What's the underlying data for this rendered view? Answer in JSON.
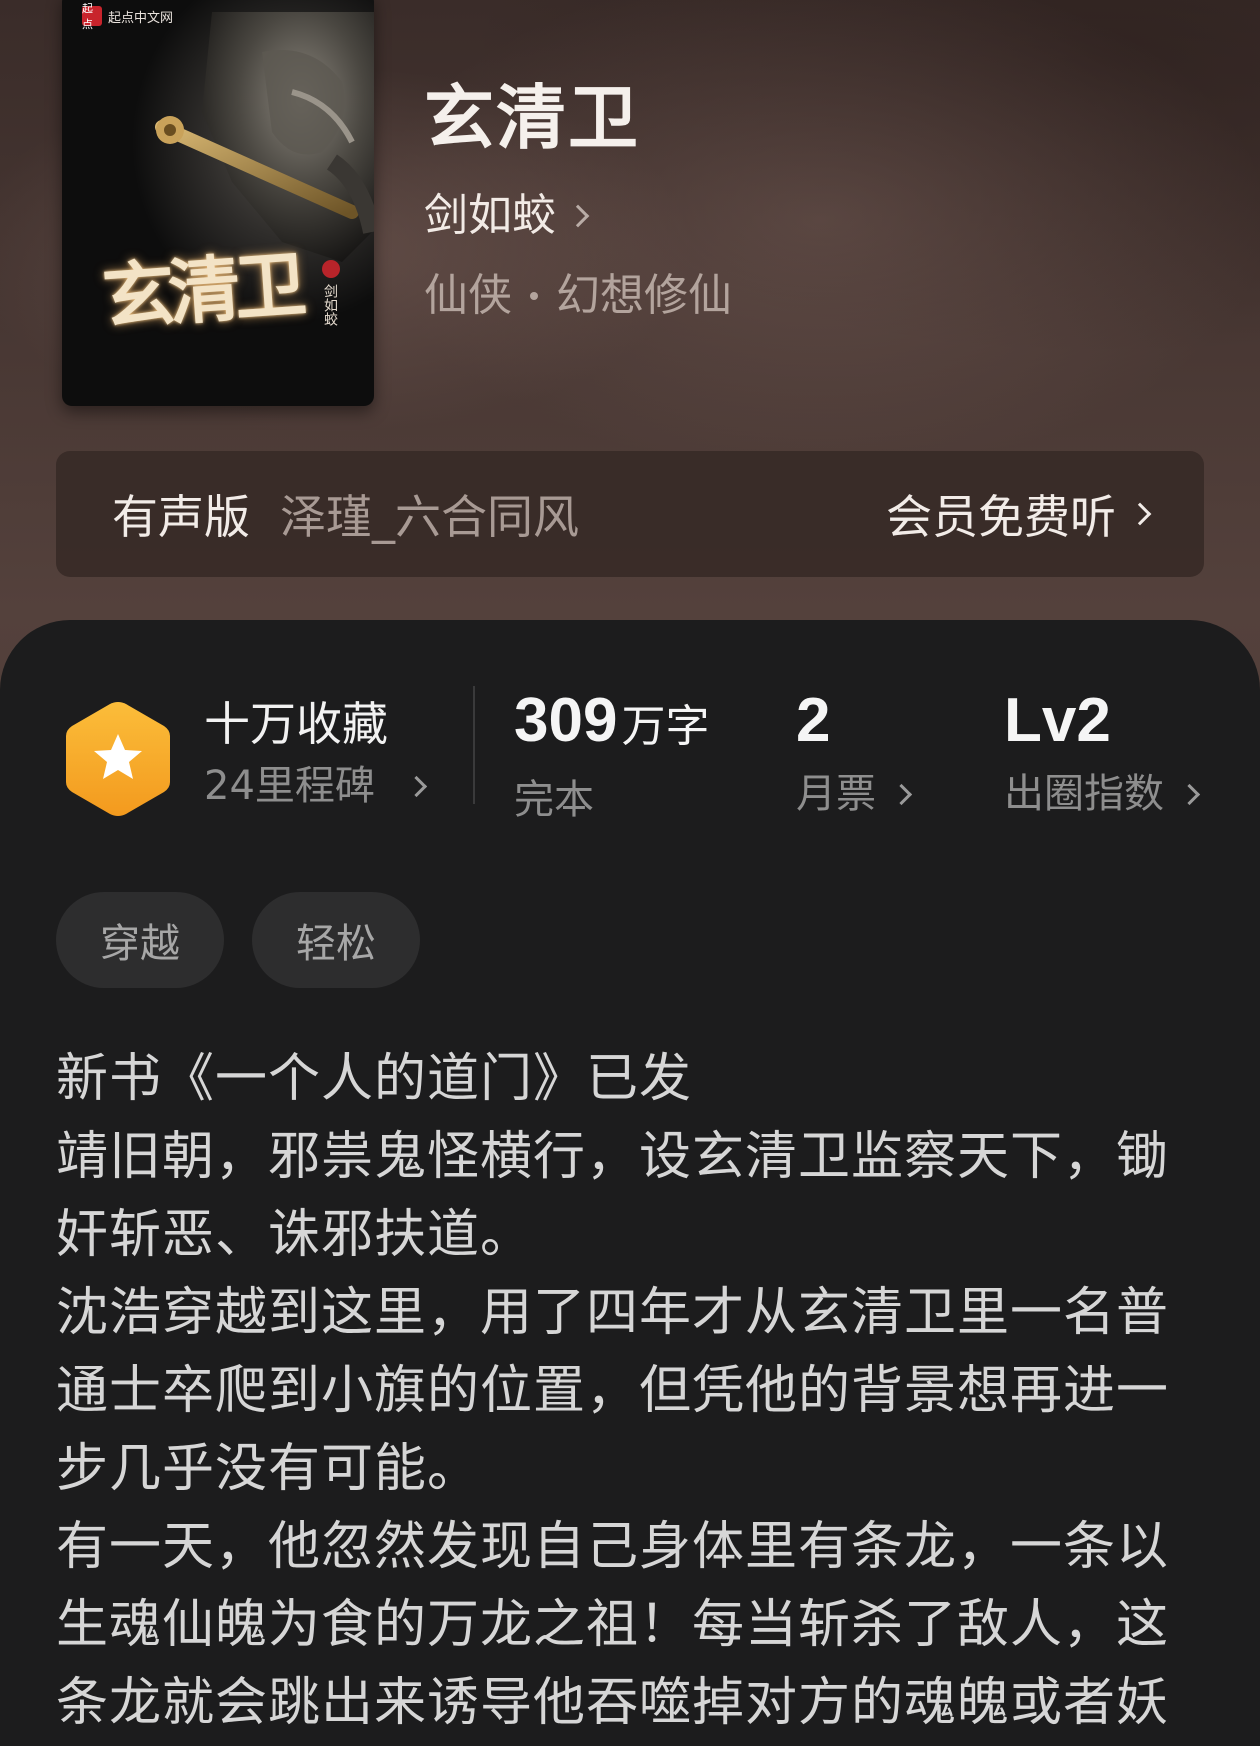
{
  "cover": {
    "publisher_badge": "起点",
    "publisher_name": "起点中文网",
    "title_art": "玄清卫",
    "author_art": "剑如蛟"
  },
  "book": {
    "title": "玄清卫",
    "author": "剑如蛟",
    "genre_primary": "仙侠",
    "genre_secondary": "幻想修仙"
  },
  "audio": {
    "label": "有声版",
    "narrator": "泽瑾_六合同风",
    "cta": "会员免费听"
  },
  "stats": {
    "collect_title": "十万收藏",
    "collect_sub": "24里程碑",
    "words_value": "309",
    "words_unit": "万字",
    "words_label": "完本",
    "monthly_value": "2",
    "monthly_label": "月票",
    "index_value": "Lv2",
    "index_label": "出圈指数"
  },
  "tags": [
    "穿越",
    "轻松"
  ],
  "description": [
    "新书《一个人的道门》已发",
    "靖旧朝，邪祟鬼怪横行，设玄清卫监察天下，锄奸斩恶、诛邪扶道。",
    "沈浩穿越到这里，用了四年才从玄清卫里一名普通士卒爬到小旗的位置，但凭他的背景想再进一步几乎没有可能。",
    "有一天，他忽然发现自己身体里有条龙，一条以生魂仙魄为食的万龙之祖！每当斩杀了敌人，这条龙就会跳出来诱导他吞噬掉对方的魂魄或者妖"
  ],
  "colors": {
    "badge_gold": "#f5a623",
    "panel_bg": "#1c1c1d"
  }
}
